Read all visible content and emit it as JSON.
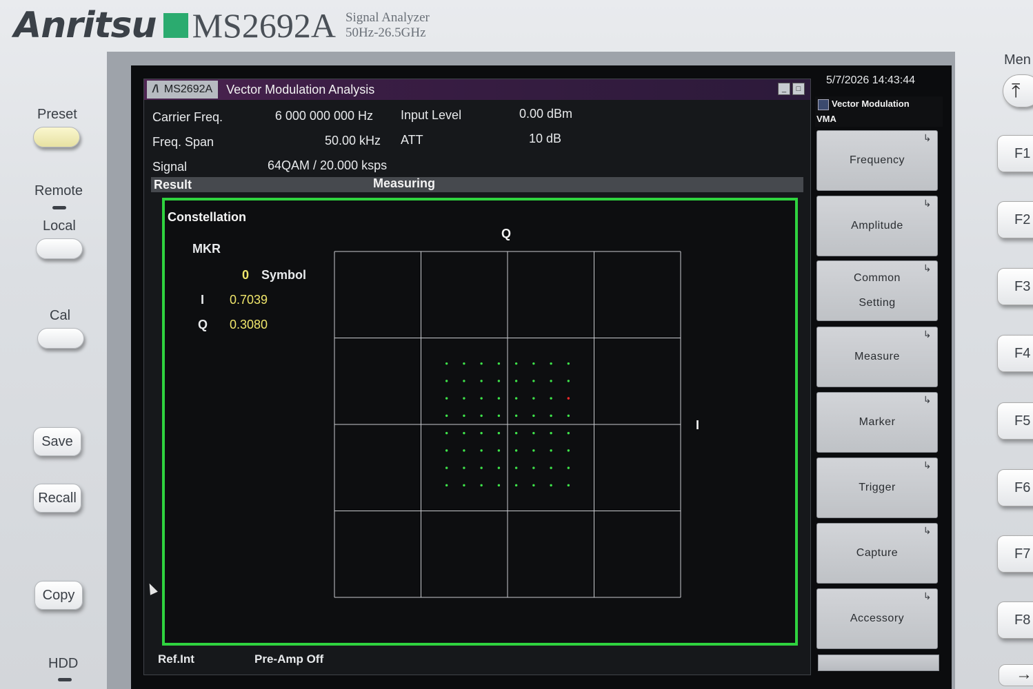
{
  "header": {
    "brand": "Anritsu",
    "model": "MS2692A",
    "description_line1": "Signal Analyzer",
    "description_line2": "50Hz-26.5GHz"
  },
  "left_keys": {
    "preset": "Preset",
    "remote": "Remote",
    "local": "Local",
    "cal": "Cal",
    "save": "Save",
    "recall": "Recall",
    "copy": "Copy",
    "hdd": "HDD"
  },
  "window": {
    "tab_logo": "/\\",
    "tab_label": "MS2692A",
    "title": "Vector Modulation Analysis",
    "min_glyph": "_",
    "max_glyph": "□"
  },
  "params": {
    "carrier_freq_label": "Carrier Freq.",
    "carrier_freq_value": "6 000 000 000 Hz",
    "freq_span_label": "Freq. Span",
    "freq_span_value": "50.00 kHz",
    "signal_label": "Signal",
    "signal_value": "64QAM / 20.000 ksps",
    "input_level_label": "Input Level",
    "input_level_value": "0.00 dBm",
    "att_label": "ATT",
    "att_value": "10 dB"
  },
  "result": {
    "label": "Result",
    "status": "Measuring"
  },
  "graph": {
    "title": "Constellation",
    "marker_label": "MKR",
    "marker_number": "0",
    "marker_unit": "Symbol",
    "marker_i_label": "I",
    "marker_i_value": "0.7039",
    "marker_q_label": "Q",
    "marker_q_value": "0.3080",
    "axis_q": "Q",
    "axis_i": "I"
  },
  "chart_data": {
    "type": "scatter",
    "title": "Constellation",
    "xlabel": "I",
    "ylabel": "Q",
    "grid": true,
    "grid_divisions": 4,
    "xlim": [
      -2,
      2
    ],
    "ylim": [
      -2,
      2
    ],
    "modulation": "64QAM",
    "series": [
      {
        "name": "Symbols",
        "color": "#3ee34a",
        "points_i": [
          -0.7039,
          -0.5028,
          -0.3017,
          -0.1006,
          0.1006,
          0.3017,
          0.5028,
          0.7039
        ],
        "points_q": [
          -0.7039,
          -0.5028,
          -0.3017,
          -0.1006,
          0.1006,
          0.3017,
          0.5028,
          0.7039
        ]
      }
    ],
    "marker": {
      "i": 0.7039,
      "q": 0.308,
      "color": "#ff2a2a"
    }
  },
  "status": {
    "ref": "Ref.Int",
    "preamp": "Pre-Amp Off"
  },
  "side_panel": {
    "clock": "5/7/2026 14:43:44",
    "title": "Vector Modulation",
    "subtitle": "VMA",
    "softkeys": [
      {
        "line1": "Frequency",
        "line2": ""
      },
      {
        "line1": "Amplitude",
        "line2": ""
      },
      {
        "line1": "Common",
        "line2": "Setting"
      },
      {
        "line1": "Measure",
        "line2": ""
      },
      {
        "line1": "Marker",
        "line2": ""
      },
      {
        "line1": "Trigger",
        "line2": ""
      },
      {
        "line1": "Capture",
        "line2": ""
      },
      {
        "line1": "Accessory",
        "line2": ""
      }
    ]
  },
  "right_keys": {
    "menu": "Men",
    "menu_glyph": "⤒",
    "f1": "F1",
    "f2": "F2",
    "f3": "F3",
    "f4": "F4",
    "f5": "F5",
    "f6": "F6",
    "f7": "F7",
    "f8": "F8",
    "next_glyph": "→"
  },
  "colors": {
    "frame_green": "#2fd33f",
    "symbol_green": "#3ee34a",
    "marker_red": "#ff2a2a",
    "marker_value_yellow": "#f0e66b",
    "title_purple": "#4e2452"
  }
}
